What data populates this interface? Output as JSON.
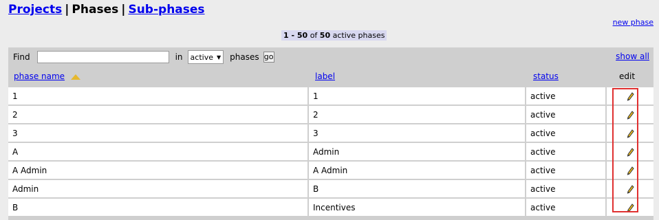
{
  "nav": {
    "projects": "Projects",
    "separator1": "|",
    "phases": "Phases",
    "separator2": "|",
    "subphases": "Sub-phases"
  },
  "new_phase_link": "new phase",
  "count": {
    "range": "1 - 50",
    "of": "of",
    "total": "50",
    "suffix": "active phases"
  },
  "filter": {
    "find_label": "Find",
    "find_value": "",
    "in_label": "in",
    "status_value": "active",
    "phases_label": "phases",
    "go_label": "go",
    "show_all": "show all"
  },
  "columns": {
    "phase_name": "phase name",
    "label": "label",
    "status": "status",
    "edit": "edit"
  },
  "sort": {
    "column": "phase name",
    "direction": "ascending",
    "icon": "sort-ascending-icon"
  },
  "rows": [
    {
      "phase_name": "1",
      "label": "1",
      "status": "active"
    },
    {
      "phase_name": "2",
      "label": "2",
      "status": "active"
    },
    {
      "phase_name": "3",
      "label": "3",
      "status": "active"
    },
    {
      "phase_name": "A",
      "label": "Admin",
      "status": "active"
    },
    {
      "phase_name": "A Admin",
      "label": "A Admin",
      "status": "active"
    },
    {
      "phase_name": "Admin",
      "label": "B",
      "status": "active"
    },
    {
      "phase_name": "B",
      "label": "Incentives",
      "status": "active"
    }
  ],
  "colors": {
    "page_bg": "#ececec",
    "panel_bg": "#cfcfcf",
    "link": "#0000ee",
    "highlight": "#e03030",
    "sort_icon": "#e6b82e"
  }
}
